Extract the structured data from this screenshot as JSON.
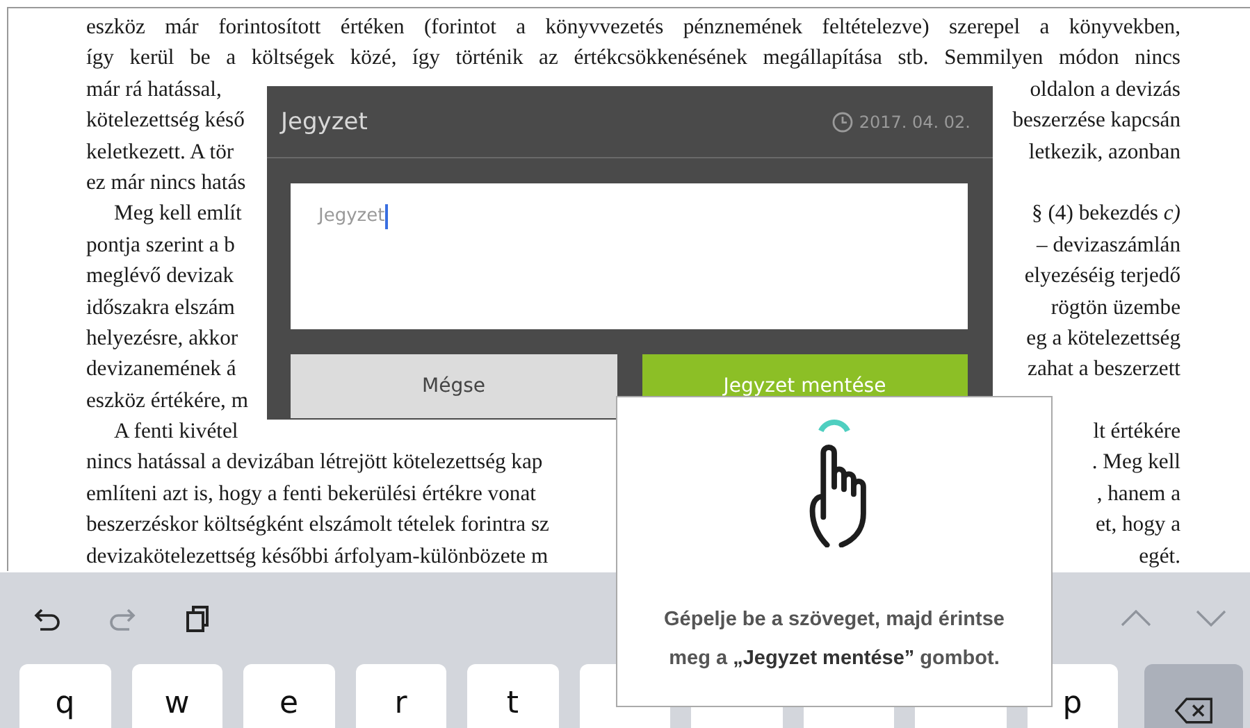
{
  "book": {
    "lines": [
      {
        "left": "eszköz már forintosított értéken (forintot a könyvvezetés pénznemének feltételezve) szerepel a könyvekben,",
        "indent": false,
        "justified": true
      },
      {
        "left": "így kerül be a költségek közé, így történik az értékcsökkenésének megállapítása stb. Semmilyen módon nincs",
        "indent": false,
        "justified": true
      },
      {
        "left": "már rá hatással,",
        "right": "oldalon a devizás",
        "indent": false
      },
      {
        "left": "kötelezettség késő",
        "right": "beszerzése kapcsán",
        "indent": false
      },
      {
        "left": "keletkezett. A tör",
        "right": "letkezik, azonban",
        "indent": false
      },
      {
        "left": "ez már nincs hatás",
        "indent": false
      },
      {
        "left": "Meg kell említ",
        "right": "§ (4) bekezdés *c)*",
        "indent": true
      },
      {
        "left": "pontja szerint a b",
        "right": "– devizaszámlán",
        "indent": false
      },
      {
        "left": "meglévő devizak",
        "right": "elyezéséig terjedő",
        "indent": false
      },
      {
        "left": "időszakra elszám",
        "right": "rögtön üzembe",
        "indent": false
      },
      {
        "left": "helyezésre, akkor",
        "right": "eg a kötelezettség",
        "indent": false
      },
      {
        "left": "devizanemének á",
        "right": "zahat a beszerzett",
        "indent": false
      },
      {
        "left": "eszköz értékére, m",
        "indent": false
      },
      {
        "left": "A fenti kivétel",
        "right": "lt értékére",
        "indent": true
      },
      {
        "left": "nincs hatással a devizában létrejött kötelezettség kap",
        "right": ". Meg kell",
        "indent": false
      },
      {
        "left": "említeni azt is, hogy a fenti bekerülési értékre vonat",
        "right": ", hanem a",
        "indent": false
      },
      {
        "left": "beszerzéskor költségként elszámolt tételek forintra sz",
        "right": "et, hogy a",
        "indent": false
      },
      {
        "left": "devizakötelezettség későbbi árfolyam-különbözete m",
        "right": "egét.",
        "indent": false
      }
    ]
  },
  "dialog": {
    "title": "Jegyzet",
    "date": "2017. 04. 02.",
    "note": {
      "placeholder": "Jegyzet",
      "focused": true
    },
    "buttons": [
      {
        "label": "Mégse",
        "kind": "cancel"
      },
      {
        "label": "Jegyzet mentése",
        "kind": "primary"
      }
    ]
  },
  "tooltip": {
    "text": "Gépelje be a szöveget, majd érintse meg a **„Jegyzet mentése”** gombot."
  },
  "keyboard": {
    "toolbar": [
      {
        "kind": "undo",
        "disabled": false
      },
      {
        "kind": "redo",
        "disabled": true
      },
      {
        "kind": "paste",
        "disabled": false
      }
    ],
    "nav": [
      {
        "kind": "up",
        "disabled": true
      },
      {
        "kind": "down",
        "disabled": true
      }
    ],
    "keys": [
      {
        "label": "q",
        "kind": "letter"
      },
      {
        "label": "w",
        "kind": "letter"
      },
      {
        "label": "e",
        "kind": "letter"
      },
      {
        "label": "r",
        "kind": "letter"
      },
      {
        "label": "t",
        "kind": "letter"
      },
      {
        "kind": "covered"
      },
      {
        "kind": "covered"
      },
      {
        "kind": "covered"
      },
      {
        "kind": "covered"
      },
      {
        "label": "p",
        "kind": "letter"
      }
    ]
  }
}
